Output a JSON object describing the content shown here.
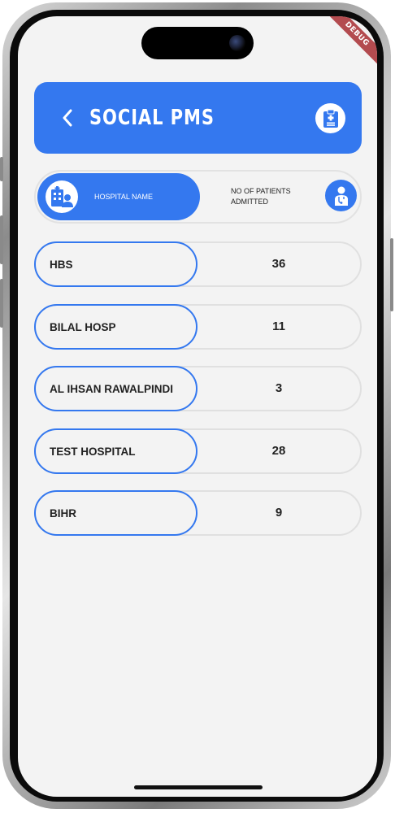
{
  "app_bar": {
    "title": "SOCIAL PMS",
    "back_icon": "chevron-left-icon",
    "action_icon": "clipboard-medical-icon"
  },
  "debug_banner": "DEBUG",
  "table_header": {
    "hospital_label": "HOSPITAL NAME",
    "patients_label": "NO OF PATIENTS ADMITTED",
    "hospital_icon": "hospital-building-icon",
    "patient_icon": "patient-icon"
  },
  "rows": [
    {
      "name": "HBS",
      "count": "36"
    },
    {
      "name": "BILAL HOSP",
      "count": "11"
    },
    {
      "name": "AL IHSAN RAWALPINDI",
      "count": "3"
    },
    {
      "name": "TEST HOSPITAL",
      "count": "28"
    },
    {
      "name": "BIHR",
      "count": "9"
    }
  ],
  "colors": {
    "primary": "#3478ef",
    "background": "#f3f3f3",
    "debug": "#b34b4f"
  }
}
